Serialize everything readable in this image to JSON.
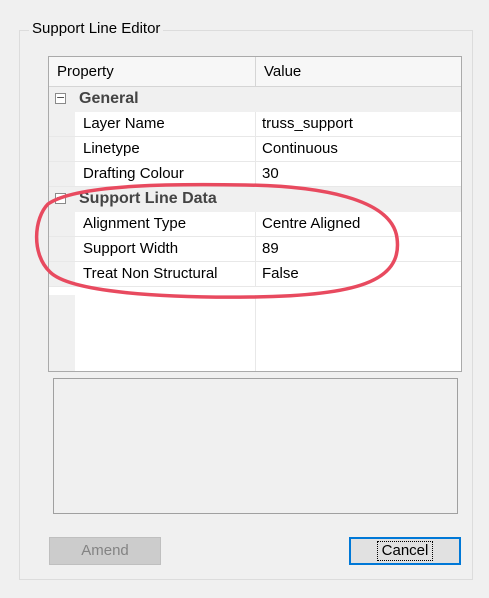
{
  "group": {
    "title": "Support Line Editor"
  },
  "grid": {
    "header": {
      "property": "Property",
      "value": "Value"
    },
    "categories": [
      {
        "label": "General",
        "toggle": "−",
        "rows": [
          {
            "property": "Layer Name",
            "value": "truss_support"
          },
          {
            "property": "Linetype",
            "value": "Continuous"
          },
          {
            "property": "Drafting Colour",
            "value": "30"
          }
        ]
      },
      {
        "label": "Support Line Data",
        "toggle": "−",
        "rows": [
          {
            "property": "Alignment Type",
            "value": "Centre Aligned"
          },
          {
            "property": "Support Width",
            "value": "89"
          },
          {
            "property": "Treat Non Structural",
            "value": "False"
          }
        ]
      }
    ]
  },
  "buttons": {
    "amend": "Amend",
    "cancel": "Cancel"
  },
  "colors": {
    "annotation": "#e84a5f",
    "focus_border": "#0078d7"
  },
  "icons": {
    "collapse": "minus-box-icon"
  }
}
